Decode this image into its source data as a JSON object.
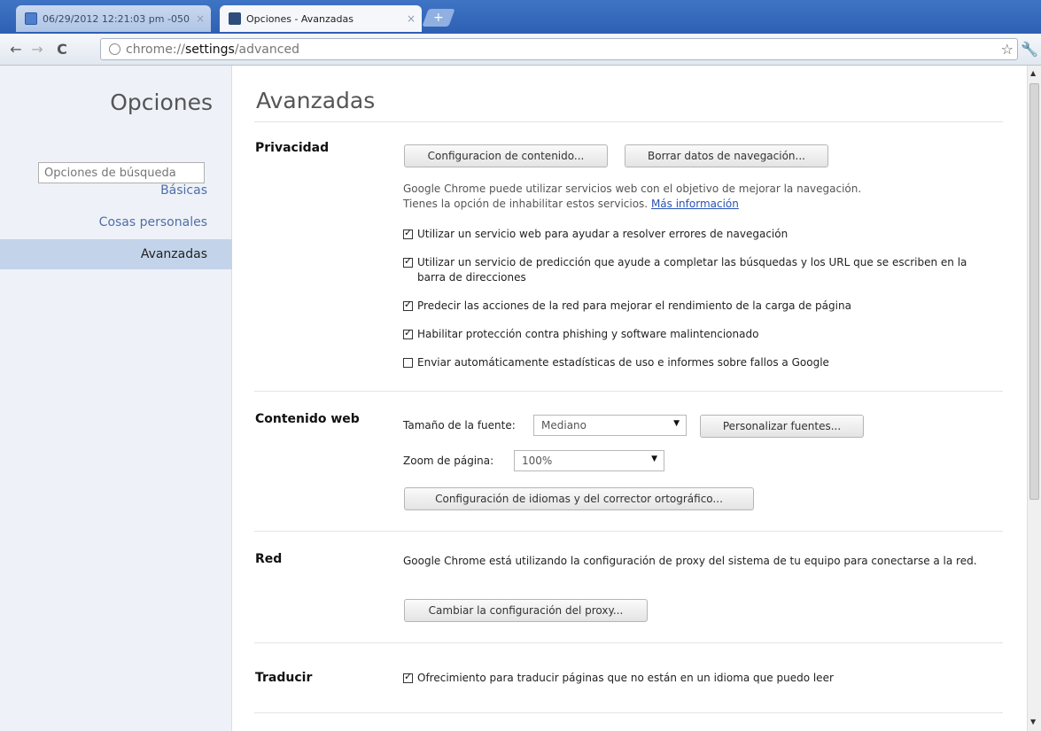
{
  "tabs": [
    {
      "title": "06/29/2012 12:21:03 pm -050",
      "close": "×"
    },
    {
      "title": "Opciones - Avanzadas",
      "close": "×"
    }
  ],
  "new_tab": "+",
  "toolbar": {
    "back": "←",
    "forward": "→",
    "reload": "C",
    "url_scheme": "chrome://",
    "url_host": "settings",
    "url_path": "/advanced",
    "star": "☆",
    "wrench": "🔧"
  },
  "sidebar": {
    "title": "Opciones",
    "search_placeholder": "Opciones de búsqueda",
    "items": [
      {
        "label": "Básicas"
      },
      {
        "label": "Cosas personales"
      },
      {
        "label": "Avanzadas"
      }
    ]
  },
  "main": {
    "title": "Avanzadas",
    "privacy": {
      "title": "Privacidad",
      "content_settings": "Configuracion de contenido...",
      "clear_data": "Borrar datos de navegación...",
      "note_line1": "Google Chrome puede utilizar servicios web con el objetivo de mejorar la navegación.",
      "note_line2": "Tienes la opción de inhabilitar estos servicios.",
      "more_info": "Más información",
      "checks": [
        {
          "label": "Utilizar un servicio web para ayudar a resolver errores de navegación",
          "checked": true
        },
        {
          "label": "Utilizar un servicio de predicción que ayude a completar las búsquedas y los URL que se escriben en la barra de direcciones",
          "checked": true
        },
        {
          "label": "Predecir las acciones de la red para mejorar el rendimiento de la carga de página",
          "checked": true
        },
        {
          "label": "Habilitar protección contra phishing y software malintencionado",
          "checked": true
        },
        {
          "label": "Enviar automáticamente estadísticas de uso e informes sobre fallos a Google",
          "checked": false
        }
      ]
    },
    "web_content": {
      "title": "Contenido web",
      "font_size_label": "Tamaño de la fuente:",
      "font_size_value": "Mediano",
      "customize_fonts": "Personalizar fuentes...",
      "zoom_label": "Zoom de página:",
      "zoom_value": "100%",
      "languages_button": "Configuración de idiomas y del corrector ortográfico..."
    },
    "network": {
      "title": "Red",
      "text": "Google Chrome está utilizando la configuración de proxy del sistema de tu equipo para conectarse a la red.",
      "proxy_button": "Cambiar la configuración del proxy..."
    },
    "translate": {
      "title": "Traducir",
      "check_label": "Ofrecimiento para traducir páginas que no están en un idioma que puedo leer",
      "checked": true
    }
  }
}
